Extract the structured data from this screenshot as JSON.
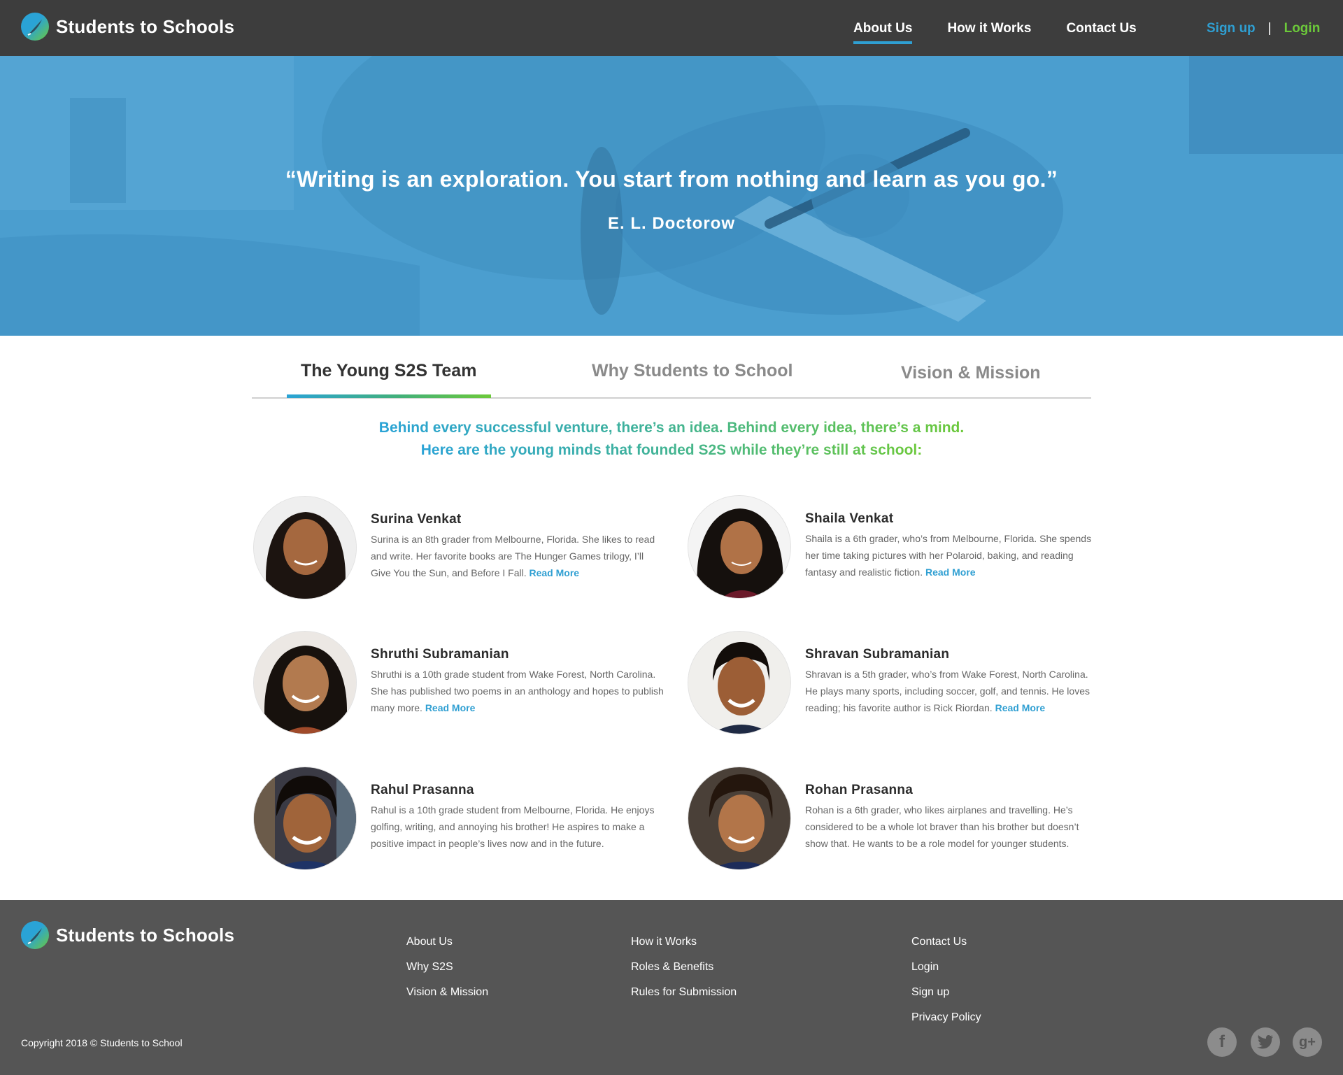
{
  "brand": {
    "name": "Students to Schools"
  },
  "nav": {
    "items": [
      {
        "label": "About Us",
        "active": true
      },
      {
        "label": "How it Works",
        "active": false
      },
      {
        "label": "Contact Us",
        "active": false
      }
    ],
    "signup": "Sign up",
    "separator": "|",
    "login": "Login"
  },
  "hero": {
    "quote": "“Writing is an exploration. You start from nothing and learn as you go.”",
    "author": "E. L. Doctorow"
  },
  "tabs": [
    {
      "label": "The Young S2S Team",
      "active": true
    },
    {
      "label": "Why Students to School",
      "active": false
    },
    {
      "label": "Vision & Mission",
      "active": false
    }
  ],
  "intro": {
    "line1": "Behind every successful venture, there’s an idea. Behind every idea, there’s a mind.",
    "line2": "Here are the young minds that founded S2S while they’re still at school:"
  },
  "team": [
    {
      "name": "Surina Venkat",
      "bio": "Surina is an 8th grader from Melbourne, Florida. She likes to read and write. Her favorite books are The Hunger Games trilogy, I’ll Give You the Sun, and Before I Fall.",
      "more": "Read More"
    },
    {
      "name": "Shaila Venkat",
      "bio": "Shaila is a 6th grader, who’s from Melbourne, Florida. She spends her time taking pictures with her Polaroid, baking, and reading fantasy and realistic fiction.",
      "more": "Read More"
    },
    {
      "name": "Shruthi Subramanian",
      "bio": "Shruthi is a 10th grade student from Wake Forest, North Carolina. She has published two poems in an anthology and hopes to publish many more.",
      "more": "Read More"
    },
    {
      "name": "Shravan Subramanian",
      "bio": "Shravan is a 5th grader, who’s from Wake Forest, North Carolina. He plays many sports, including soccer, golf, and tennis. He loves reading; his favorite author is Rick Riordan.",
      "more": "Read More"
    },
    {
      "name": "Rahul Prasanna",
      "bio": "Rahul is a 10th grade student from Melbourne, Florida. He enjoys golfing, writing, and annoying his brother! He aspires to make a positive impact in people’s lives now and in the future.",
      "more": ""
    },
    {
      "name": "Rohan Prasanna",
      "bio": "Rohan is a 6th grader, who likes airplanes and travelling. He’s considered to be a whole lot braver than his brother but doesn’t show that. He wants to be a role model for younger students.",
      "more": ""
    }
  ],
  "footer": {
    "col1": [
      "About Us",
      "Why S2S",
      "Vision & Mission"
    ],
    "col2": [
      "How it Works",
      "Roles & Benefits",
      "Rules for Submission"
    ],
    "col3": [
      "Contact Us",
      "Login",
      "Sign up",
      "Privacy Policy"
    ],
    "copyright": "Copyright 2018 ©  Students to School",
    "social": [
      {
        "icon": "facebook-icon",
        "glyph": "f"
      },
      {
        "icon": "twitter-icon",
        "glyph": "t"
      },
      {
        "icon": "google-plus-icon",
        "glyph": "g+"
      }
    ]
  },
  "colors": {
    "header_bg": "#3d3d3d",
    "accent_blue": "#2f9fd2",
    "accent_green": "#6cc93a",
    "footer_bg": "#555555",
    "hero_overlay": "#4a9fd0"
  }
}
